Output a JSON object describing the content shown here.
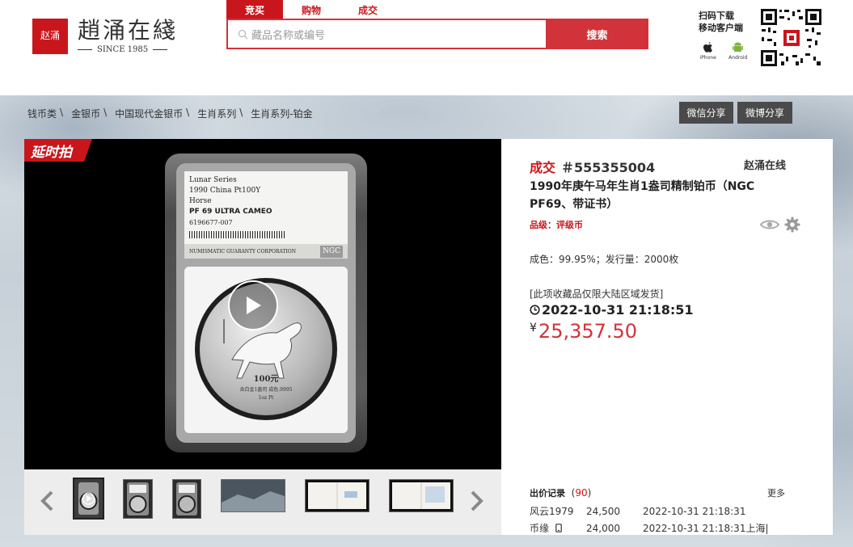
{
  "brand": {
    "seal_text": "赵涌",
    "name": "趙涌在綫",
    "since": "SINCE 1985"
  },
  "search": {
    "tabs": [
      {
        "label": "竞买",
        "active": true
      },
      {
        "label": "购物",
        "active": false
      },
      {
        "label": "成交",
        "active": false
      }
    ],
    "placeholder": "藏品名称或编号",
    "button": "搜索"
  },
  "download": {
    "line1": "扫码下载",
    "line2": "移动客户端",
    "ios": "iPhone",
    "android": "Android"
  },
  "breadcrumb": [
    "钱币类",
    "金银币",
    "中国现代金银币",
    "生肖系列",
    "生肖系列-铂金"
  ],
  "share": {
    "wechat": "微信分享",
    "weibo": "微博分享"
  },
  "media": {
    "badge": "延时拍",
    "slab_label": {
      "line1": "Lunar Series",
      "line2": "1990 China Pt100Y",
      "line3": "Horse",
      "grade": "PF 69 ULTRA CAMEO",
      "cert": "6196677-007",
      "footer": "NUMISMATIC GUARANTY CORPORATION",
      "logo": "NGC"
    },
    "coin": {
      "denomination": "100元",
      "inscription": "含白金1盎司 成色.9995",
      "weight": "1oz Pt"
    }
  },
  "lot": {
    "status": "成交",
    "number": "＃555355004",
    "seller": "赵涌在线",
    "title": "1990年庚午马年生肖1盎司精制铂币（NGC PF69、带证书）",
    "grade_label": "品级：评级币",
    "specs": "成色：99.95%；发行量：2000枚",
    "notice": "[此项收藏品仅限大陆区域发货]",
    "time": "2022-10-31 21:18:51",
    "currency": "¥",
    "price": "25,357.50"
  },
  "bid_history": {
    "label": "出价记录",
    "count": "90",
    "more": "更多",
    "rows": [
      {
        "user": "风云1979",
        "amount": "24,500",
        "time": "2022-10-31 21:18:31",
        "extra": ""
      },
      {
        "user": "币缘",
        "amount": "24,000",
        "time": "2022-10-31 21:18:31",
        "extra": "上海|"
      }
    ]
  },
  "colors": {
    "brand_red": "#c9161d",
    "price_red": "#d2333a"
  }
}
